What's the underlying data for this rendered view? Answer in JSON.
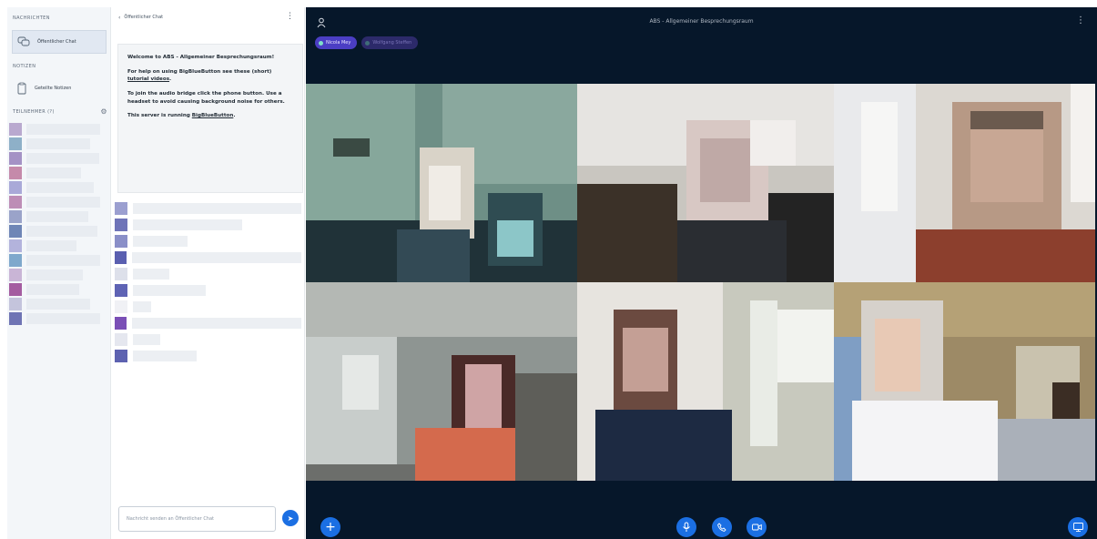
{
  "userlist": {
    "messages_title": "NACHRICHTEN",
    "public_chat_label": "Öffentlicher Chat",
    "notes_title": "NOTIZEN",
    "shared_notes_label": "Geteilte Notizen",
    "participants_title": "TEILNEHMER (?)",
    "participants": [
      {
        "color": "#b9a9cf",
        "name_w": 84
      },
      {
        "color": "#8eb0c8",
        "name_w": 70
      },
      {
        "color": "#a492c5",
        "name_w": 80
      },
      {
        "color": "#c58aaa",
        "name_w": 60
      },
      {
        "color": "#a9a9d8",
        "name_w": 74
      },
      {
        "color": "#bd8db6",
        "name_w": 82
      },
      {
        "color": "#9aa3c9",
        "name_w": 68
      },
      {
        "color": "#6f86b6",
        "name_w": 78
      },
      {
        "color": "#b3b3dc",
        "name_w": 55
      },
      {
        "color": "#7fa8cc",
        "name_w": 84
      },
      {
        "color": "#c9b5d6",
        "name_w": 62
      },
      {
        "color": "#a45ca0",
        "name_w": 58
      },
      {
        "color": "#c4c4dc",
        "name_w": 70
      },
      {
        "color": "#6f74b4",
        "name_w": 84
      }
    ]
  },
  "chat": {
    "header_title": "Öffentlicher Chat",
    "welcome": {
      "p1_prefix": "Welcome to ",
      "p1_room": "ABS - Allgemeiner Besprechungsraum",
      "p1_suffix": "!",
      "p2_prefix": "For help on using BigBlueButton see these (short) ",
      "p2_link": "tutorial videos",
      "p2_suffix": ".",
      "p3": "To join the audio bridge click the phone button. Use a headset to avoid causing background noise for others.",
      "p4_prefix": "This server is running ",
      "p4_link": "BigBlueButton",
      "p4_suffix": "."
    },
    "messages": [
      {
        "color": "#9b9fd0",
        "w": 190
      },
      {
        "color": "#6f74b8",
        "w": 120
      },
      {
        "color": "#8a8fc8",
        "w": 60
      },
      {
        "color": "#5a5fb0",
        "w": 196
      },
      {
        "color": "#dde0ea",
        "w": 40
      },
      {
        "color": "#5e63b4",
        "w": 80
      },
      {
        "color": "#f0f1f5",
        "w": 20
      },
      {
        "color": "#7a4fb6",
        "w": 196
      },
      {
        "color": "#e5e7ef",
        "w": 30
      },
      {
        "color": "#5d62b0",
        "w": 70
      }
    ],
    "input_placeholder": "Nachricht senden an Öffentlicher Chat"
  },
  "main": {
    "room_title": "ABS - Allgemeiner Besprechungsraum",
    "talkers": [
      {
        "name": "Nicola Mey",
        "active": true
      },
      {
        "name": "Wolfgang Steffen",
        "active": false
      }
    ]
  },
  "colors": {
    "primary": "#1b6fe3",
    "main_bg": "#06172a",
    "sidebar_bg": "#f3f6f9"
  },
  "icons": {
    "user": "user-icon",
    "chat": "chat-bubbles-icon",
    "notes": "notes-icon",
    "gear": "gear-icon",
    "kebab": "kebab-menu-icon",
    "plus": "plus-icon",
    "mic": "microphone-icon",
    "phone": "phone-icon",
    "camera": "camera-icon",
    "screen": "screen-share-icon",
    "send": "send-icon"
  }
}
